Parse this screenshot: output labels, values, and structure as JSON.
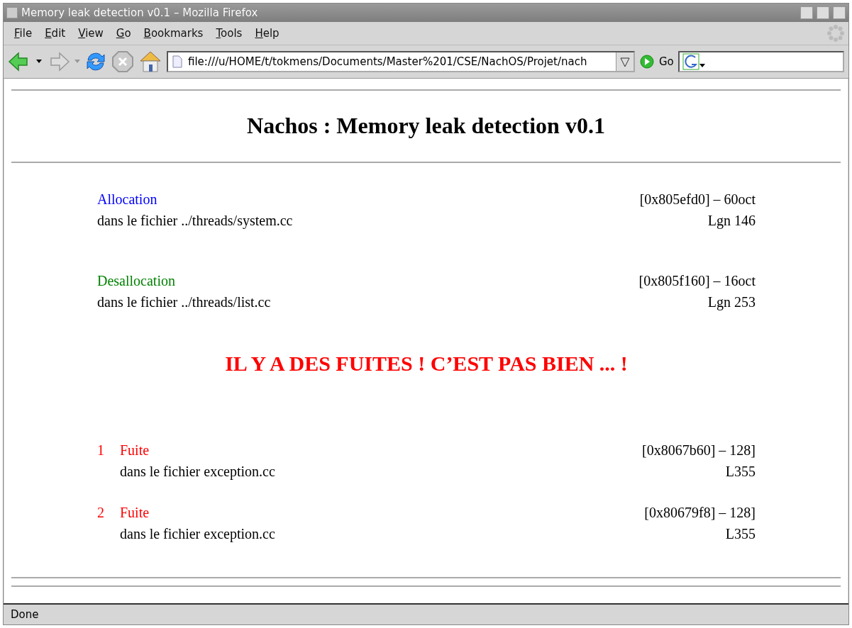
{
  "window": {
    "title": "Memory leak detection v0.1 – Mozilla Firefox"
  },
  "menu": [
    "File",
    "Edit",
    "View",
    "Go",
    "Bookmarks",
    "Tools",
    "Help"
  ],
  "toolbar": {
    "url": "file:///u/HOME/t/tokmens/Documents/Master%201/CSE/NachOS/Projet/nach",
    "go": "Go"
  },
  "page": {
    "heading": "Nachos : Memory leak detection v0.1",
    "entries": [
      {
        "label": "Allocation",
        "color": "#0000ff",
        "address": "[0x805efd0] – 60oct",
        "file": "dans le fichier ../threads/system.cc",
        "line": "Lgn 146"
      },
      {
        "label": "Desallocation",
        "color": "#008000",
        "address": "[0x805f160] – 16oct",
        "file": "dans le fichier ../threads/list.cc",
        "line": "Lgn 253"
      }
    ],
    "warning": "IL Y A DES FUITES ! C’EST PAS BIEN ... !",
    "leaks": [
      {
        "number": "1",
        "label": "Fuite",
        "address": "[0x8067b60] – 128]",
        "file": "dans le fichier exception.cc",
        "line": "L355"
      },
      {
        "number": "2",
        "label": "Fuite",
        "address": "[0x80679f8] – 128]",
        "file": "dans le fichier exception.cc",
        "line": "L355"
      }
    ]
  },
  "status_bar": "Done"
}
